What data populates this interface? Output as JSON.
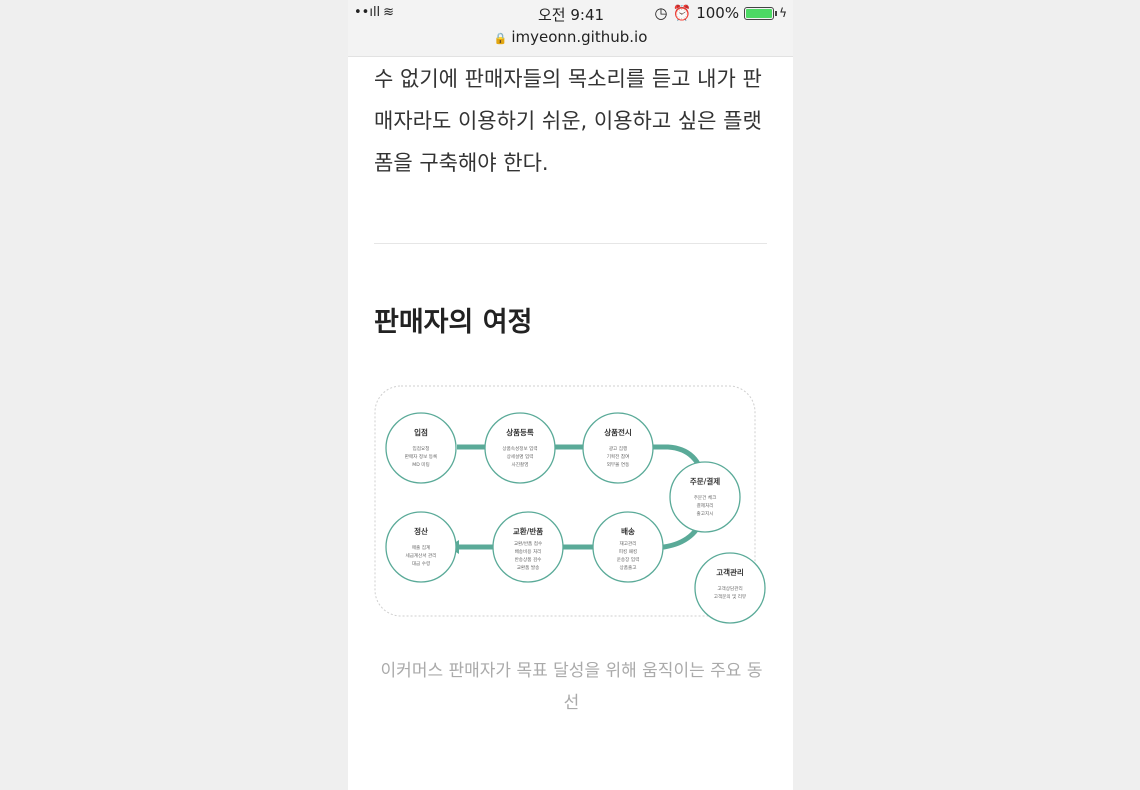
{
  "status_bar": {
    "signal": "••ıll",
    "wifi": "wifi-icon",
    "time": "오전 9:41",
    "battery_percent": "100%",
    "icons": [
      "clock-icon",
      "alarm-icon",
      "battery-icon",
      "charging-icon"
    ]
  },
  "browser": {
    "url": "imyeonn.github.io"
  },
  "article": {
    "paragraph": "수 없기에 판매자들의 목소리를 듣고 내가 판매자라도 이용하기 쉬운, 이용하고 싶은 플랫폼을 구축해야 한다.",
    "heading": "판매자의 여정",
    "caption": "이커머스 판매자가 목표 달성을 위해 움직이는 주요 동선"
  },
  "journey": {
    "accent_color": "#5aaa98",
    "steps": [
      {
        "title": "입점",
        "lines": [
          "입점요청",
          "판매자 정보 등록",
          "MD 미팅"
        ]
      },
      {
        "title": "상품등록",
        "lines": [
          "상품속성정보 입력",
          "상세설명 입력",
          "사진촬영"
        ]
      },
      {
        "title": "상품전시",
        "lines": [
          "광고 집행",
          "기획전 참여",
          "외부몰 연동"
        ]
      },
      {
        "title": "주문/결제",
        "lines": [
          "주문건 체크",
          "결제처리",
          "출고지시"
        ]
      },
      {
        "title": "배송",
        "lines": [
          "재고관리",
          "피킹 패킹",
          "운송장 입력",
          "상품출고"
        ]
      },
      {
        "title": "교환/반품",
        "lines": [
          "교환/반품 접수",
          "배송비용 처리",
          "반송상품 검수",
          "교환품 발송"
        ]
      },
      {
        "title": "정산",
        "lines": [
          "매출 집계",
          "세금계산서 관리",
          "대금 수령"
        ]
      },
      {
        "title": "고객관리",
        "lines": [
          "고객상담관리",
          "고객문의 및 리뷰"
        ]
      }
    ]
  }
}
